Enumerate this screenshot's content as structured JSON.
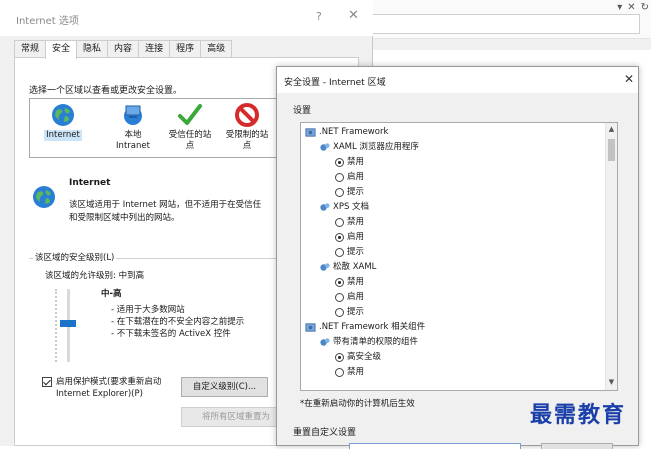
{
  "browser": {
    "glyphs": [
      "▾",
      "✕",
      "↻"
    ]
  },
  "internet_options": {
    "title": "Internet 选项",
    "help_glyph": "?",
    "close_glyph": "✕",
    "tabs": [
      {
        "label": "常规"
      },
      {
        "label": "安全",
        "active": true
      },
      {
        "label": "隐私"
      },
      {
        "label": "内容"
      },
      {
        "label": "连接"
      },
      {
        "label": "程序"
      },
      {
        "label": "高级"
      }
    ],
    "zone_prompt": "选择一个区域以查看或更改安全设置。",
    "zones": [
      {
        "label_1": "Internet",
        "label_2": "",
        "icon": "globe-icon",
        "selected": true
      },
      {
        "label_1": "本地",
        "label_2": "Intranet",
        "icon": "intranet-icon"
      },
      {
        "label_1": "受信任的站",
        "label_2": "点",
        "icon": "check-icon"
      },
      {
        "label_1": "受限制的站",
        "label_2": "点",
        "icon": "no-entry-icon"
      }
    ],
    "zone_info": {
      "title": "Internet",
      "desc_1": "该区域适用于 Internet 网站，但不适用于在受信任",
      "desc_2": "和受限制区域中列出的网站。"
    },
    "level_group_title": "该区域的安全级别(L)",
    "allowed_levels": "该区域的允许级别: 中到高",
    "level_name": "中-高",
    "level_points": [
      "- 适用于大多数网站",
      "- 在下载潜在的不安全内容之前提示",
      "- 不下载未签名的 ActiveX 控件"
    ],
    "protected_mode_1": "启用保护模式(要求重新启动",
    "protected_mode_2": "Internet Explorer)(P)",
    "custom_level_button": "自定义级别(C)...",
    "reset_all_button": "将所有区域重置为"
  },
  "security_settings": {
    "title": "安全设置 - Internet 区域",
    "close_glyph": "✕",
    "settings_label": "设置",
    "rows": [
      {
        "kind": "section",
        "label": "NET Framework",
        "prefix": "."
      },
      {
        "kind": "group",
        "label": "XAML 浏览器应用程序"
      },
      {
        "kind": "option",
        "label": "禁用",
        "selected": true
      },
      {
        "kind": "option",
        "label": "启用",
        "selected": false
      },
      {
        "kind": "option",
        "label": "提示",
        "selected": false
      },
      {
        "kind": "group",
        "label": "XPS 文档"
      },
      {
        "kind": "option",
        "label": "禁用",
        "selected": false
      },
      {
        "kind": "option",
        "label": "启用",
        "selected": true
      },
      {
        "kind": "option",
        "label": "提示",
        "selected": false
      },
      {
        "kind": "group",
        "label": "松散 XAML"
      },
      {
        "kind": "option",
        "label": "禁用",
        "selected": true
      },
      {
        "kind": "option",
        "label": "启用",
        "selected": false
      },
      {
        "kind": "option",
        "label": "提示",
        "selected": false
      },
      {
        "kind": "section",
        "label": "NET Framework 相关组件",
        "prefix": "."
      },
      {
        "kind": "group",
        "label": "带有清单的权限的组件"
      },
      {
        "kind": "option",
        "label": "高安全级",
        "selected": true
      },
      {
        "kind": "option",
        "label": "禁用",
        "selected": false
      }
    ],
    "scroll_up": "▲",
    "scroll_down": "▼",
    "footnote": "*在重新启动你的计算机后生效",
    "reset_label": "重置自定义设置"
  },
  "watermark": "最需教育"
}
